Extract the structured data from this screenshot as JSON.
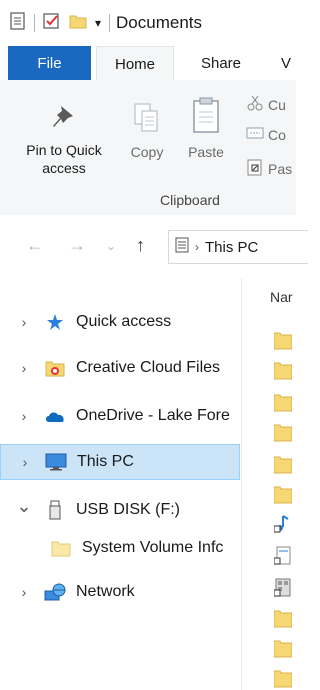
{
  "window": {
    "title": "Documents"
  },
  "ribbon_tabs": {
    "file": "File",
    "home": "Home",
    "share": "Share",
    "view": "V"
  },
  "ribbon": {
    "pin_label_line1": "Pin to Quick",
    "pin_label_line2": "access",
    "copy_label": "Copy",
    "paste_label": "Paste",
    "cut_label": "Cu",
    "copy_path_label": "Co",
    "paste_shortcut_label": "Pas",
    "group_label": "Clipboard"
  },
  "address": {
    "location": "This PC"
  },
  "file_list": {
    "name_header": "Nar"
  },
  "nav_pane": {
    "items": [
      {
        "label": "Quick access",
        "chevron": "›",
        "icon": "pin-star-icon"
      },
      {
        "label": "Creative Cloud Files",
        "chevron": "›",
        "icon": "creative-cloud-folder-icon"
      },
      {
        "label": "OneDrive - Lake Fore",
        "chevron": "›",
        "icon": "onedrive-cloud-icon"
      },
      {
        "label": "This PC",
        "chevron": "›",
        "icon": "monitor-icon",
        "selected": true
      },
      {
        "label": "USB DISK (F:)",
        "chevron": "⌄",
        "icon": "usb-drive-icon"
      },
      {
        "label": "System Volume Infc",
        "chevron": "",
        "icon": "folder-icon"
      },
      {
        "label": "Network",
        "chevron": "›",
        "icon": "network-icon"
      }
    ]
  },
  "colors": {
    "file_tab": "#1a69c1",
    "selection": "#cce4f7",
    "folder": "#f7d674"
  }
}
